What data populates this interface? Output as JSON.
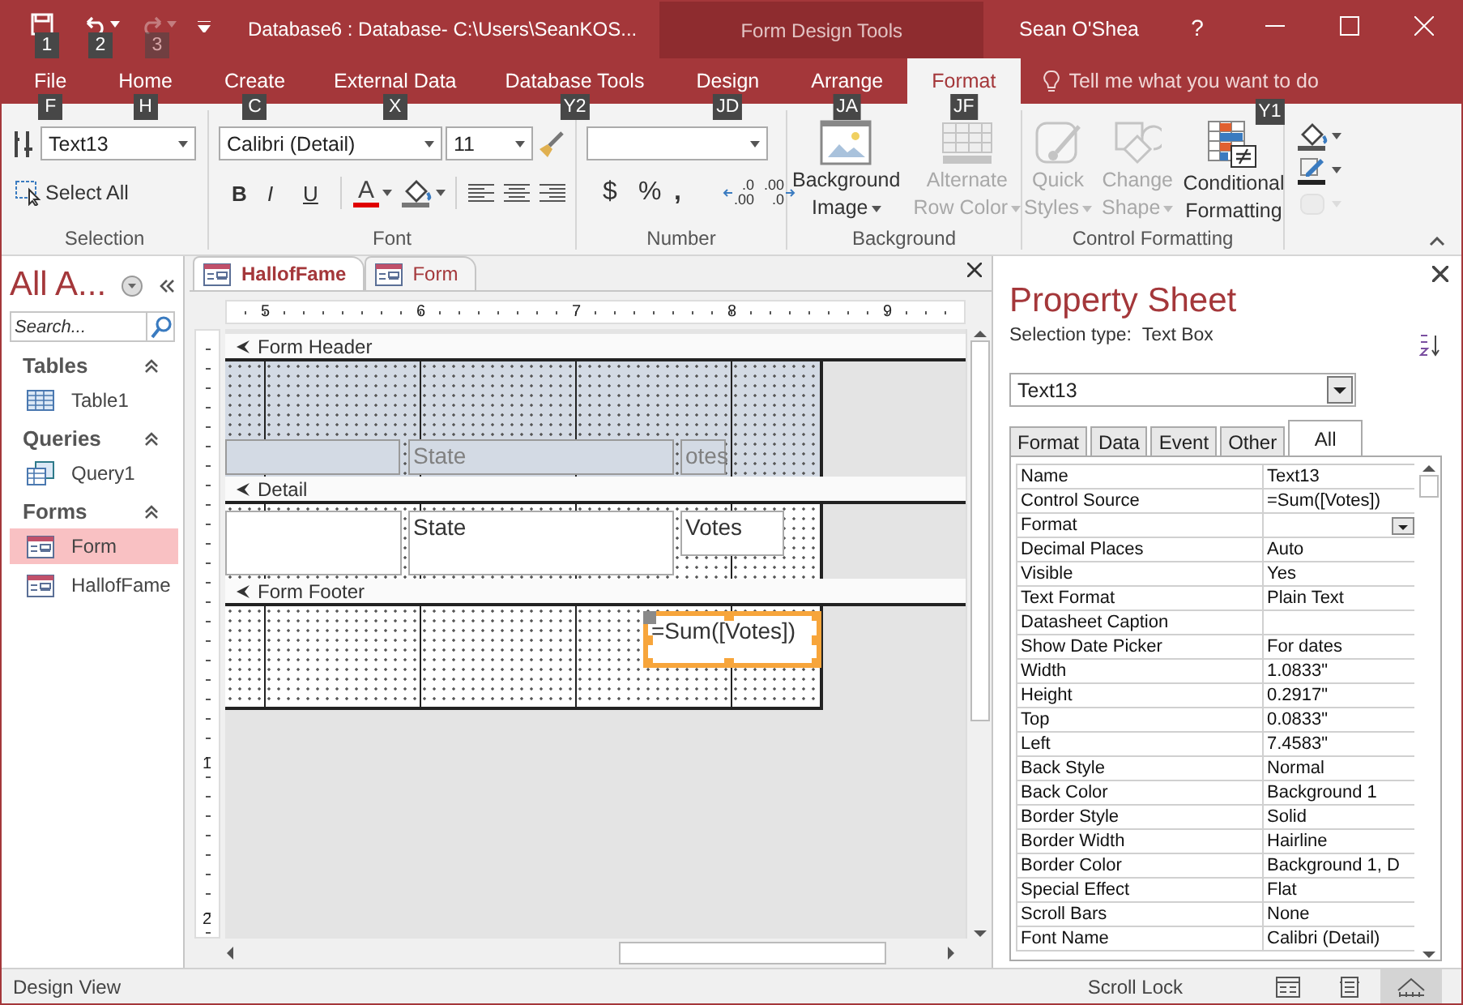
{
  "title_bar": {
    "quick_access": [
      {
        "kind": "save",
        "keytip": "1",
        "disabled": false
      },
      {
        "kind": "undo",
        "keytip": "2",
        "disabled": false
      },
      {
        "kind": "redo",
        "keytip": "3",
        "disabled": true
      }
    ],
    "title": "Database6 : Database- C:\\Users\\SeanKOS...",
    "context_tools": "Form Design Tools",
    "user": "Sean O'Shea",
    "help": "?"
  },
  "tabs": [
    {
      "label": "File",
      "keytip": "F",
      "selected": false
    },
    {
      "label": "Home",
      "keytip": "H",
      "selected": false
    },
    {
      "label": "Create",
      "keytip": "C",
      "selected": false
    },
    {
      "label": "External Data",
      "keytip": "X",
      "selected": false
    },
    {
      "label": "Database Tools",
      "keytip": "Y2",
      "selected": false
    },
    {
      "label": "Design",
      "keytip": "JD",
      "selected": false
    },
    {
      "label": "Arrange",
      "keytip": "JA",
      "selected": false
    },
    {
      "label": "Format",
      "keytip": "JF",
      "selected": true
    }
  ],
  "tell_me": {
    "placeholder": "Tell me what you want to do",
    "keytip": "Y1"
  },
  "ribbon": {
    "selection": {
      "label": "Selection",
      "object": "Text13",
      "select_all": "Select All"
    },
    "font": {
      "label": "Font",
      "font_name": "Calibri (Detail)",
      "font_size": "11",
      "styles": [
        "B",
        "I",
        "U"
      ],
      "font_color": "A"
    },
    "number": {
      "label": "Number",
      "symbols": [
        "$",
        "%",
        ","
      ],
      "decimals": [
        {
          "kind": "increase",
          "top": ".0",
          "bottom": ".00"
        },
        {
          "kind": "decrease",
          "top": ".00",
          "bottom": ".0"
        }
      ]
    },
    "background": {
      "label": "Background",
      "buttons": [
        {
          "kind": "image",
          "lines": [
            "Background",
            "Image"
          ],
          "menu": true,
          "disabled": false
        },
        {
          "kind": "rows",
          "lines": [
            "Alternate",
            "Row Color"
          ],
          "menu": true,
          "disabled": true
        }
      ]
    },
    "control_formatting": {
      "label": "Control Formatting",
      "buttons": [
        {
          "kind": "styles",
          "lines": [
            "Quick",
            "Styles"
          ],
          "menu": true,
          "disabled": true
        },
        {
          "kind": "shape",
          "lines": [
            "Change",
            "Shape"
          ],
          "menu": true,
          "disabled": true
        },
        {
          "kind": "conditional",
          "lines": [
            "Conditional",
            "Formatting"
          ],
          "menu": false,
          "disabled": false
        }
      ],
      "small_buttons": [
        {
          "kind": "fill",
          "disabled": false
        },
        {
          "kind": "outline",
          "disabled": false
        },
        {
          "kind": "effects",
          "disabled": true
        }
      ]
    }
  },
  "navigation": {
    "title": "All A...",
    "search": {
      "placeholder": "Search..."
    },
    "groups": [
      {
        "label": "Tables",
        "expanded": true,
        "items": [
          {
            "label": "Table1",
            "kind": "table",
            "selected": false
          }
        ]
      },
      {
        "label": "Queries",
        "expanded": true,
        "items": [
          {
            "label": "Query1",
            "kind": "query",
            "selected": false
          }
        ]
      },
      {
        "label": "Forms",
        "expanded": true,
        "items": [
          {
            "label": "Form",
            "kind": "form",
            "selected": true
          },
          {
            "label": "HallofFame",
            "kind": "form",
            "selected": false
          }
        ]
      }
    ]
  },
  "document": {
    "tabs": [
      {
        "label": "HallofFame",
        "selected": true
      },
      {
        "label": "Form",
        "selected": false
      }
    ],
    "ruler_marks": [
      "5",
      "6",
      "7",
      "8",
      "9"
    ],
    "vertical_ruler_marks": [
      "1",
      "2"
    ],
    "sections": [
      {
        "title": "Form Header",
        "kind": "header",
        "shaded": true,
        "controls": [
          {
            "dimmed": true,
            "selected": false
          },
          {
            "text": "State",
            "dimmed": true,
            "selected": false
          },
          {
            "text": "otes",
            "dimmed": true,
            "selected": false
          }
        ]
      },
      {
        "title": "Detail",
        "kind": "detail",
        "shaded": false,
        "controls": [
          {
            "dimmed": false,
            "selected": false
          },
          {
            "text": "State",
            "dimmed": false,
            "selected": false
          },
          {
            "text": "Votes",
            "dimmed": false,
            "selected": false
          }
        ]
      },
      {
        "title": "Form Footer",
        "kind": "footer",
        "shaded": false,
        "controls": [
          {
            "text": "=Sum([Votes])",
            "dimmed": false,
            "selected": true
          }
        ]
      }
    ]
  },
  "property_sheet": {
    "title": "Property Sheet",
    "selection_type_label": "Selection type:",
    "selection_type": "Text Box",
    "object": "Text13",
    "tabs": [
      {
        "label": "Format",
        "selected": false
      },
      {
        "label": "Data",
        "selected": false
      },
      {
        "label": "Event",
        "selected": false
      },
      {
        "label": "Other",
        "selected": false
      },
      {
        "label": "All",
        "selected": true
      }
    ],
    "rows": [
      {
        "name": "Name",
        "value": "Text13"
      },
      {
        "name": "Control Source",
        "value": "=Sum([Votes])"
      },
      {
        "name": "Format",
        "dropdown": true
      },
      {
        "name": "Decimal Places",
        "value": "Auto"
      },
      {
        "name": "Visible",
        "value": "Yes"
      },
      {
        "name": "Text Format",
        "value": "Plain Text"
      },
      {
        "name": "Datasheet Caption"
      },
      {
        "name": "Show Date Picker",
        "value": "For dates"
      },
      {
        "name": "Width",
        "value": "1.0833\""
      },
      {
        "name": "Height",
        "value": "0.2917\""
      },
      {
        "name": "Top",
        "value": "0.0833\""
      },
      {
        "name": "Left",
        "value": "7.4583\""
      },
      {
        "name": "Back Style",
        "value": "Normal"
      },
      {
        "name": "Back Color",
        "value": "Background 1"
      },
      {
        "name": "Border Style",
        "value": "Solid"
      },
      {
        "name": "Border Width",
        "value": "Hairline"
      },
      {
        "name": "Border Color",
        "value": "Background 1, D"
      },
      {
        "name": "Special Effect",
        "value": "Flat"
      },
      {
        "name": "Scroll Bars",
        "value": "None"
      },
      {
        "name": "Font Name",
        "value": "Calibri (Detail)"
      }
    ]
  },
  "status_bar": {
    "text": "Design View",
    "scroll_lock": "Scroll Lock",
    "views": [
      {
        "kind": "form",
        "selected": false
      },
      {
        "kind": "layout",
        "selected": false
      },
      {
        "kind": "design",
        "selected": true
      }
    ]
  }
}
